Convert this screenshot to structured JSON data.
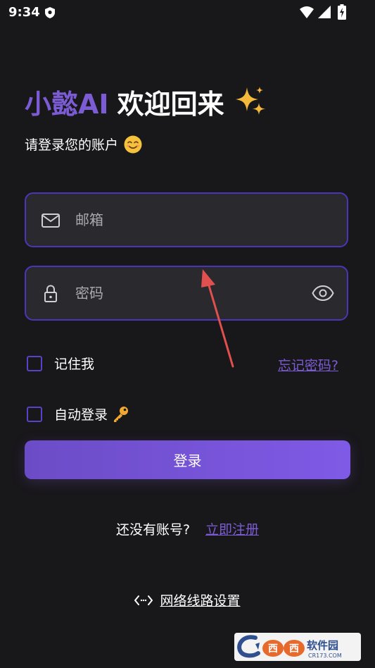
{
  "status_bar": {
    "time": "9:34",
    "icons": [
      "shield-icon",
      "wifi-icon",
      "signal-icon",
      "battery-charging-icon"
    ]
  },
  "header": {
    "brand": "小懿AI",
    "welcome": "欢迎回来",
    "sparkle_icon": "sparkles-icon",
    "subtitle": "请登录您的账户",
    "subtitle_icon": "smiling-face-icon"
  },
  "form": {
    "email_placeholder": "邮箱",
    "email_value": "",
    "password_placeholder": "密码",
    "password_value": "",
    "remember_label": "记住我",
    "remember_checked": false,
    "forgot_label": "忘记密码?",
    "auto_login_label": "自动登录",
    "auto_login_checked": false,
    "login_label": "登录"
  },
  "register": {
    "prompt": "还没有账号?",
    "link": "立即注册"
  },
  "network": {
    "label": "网络线路设置"
  },
  "watermark": {
    "text": "西西软件园",
    "subtext": "CR173.COM"
  },
  "colors": {
    "background": "#18171a",
    "accent": "#7c5cd4",
    "input_border": "#4d35b8",
    "input_bg": "#2a292d",
    "annotation": "#e0504e"
  }
}
